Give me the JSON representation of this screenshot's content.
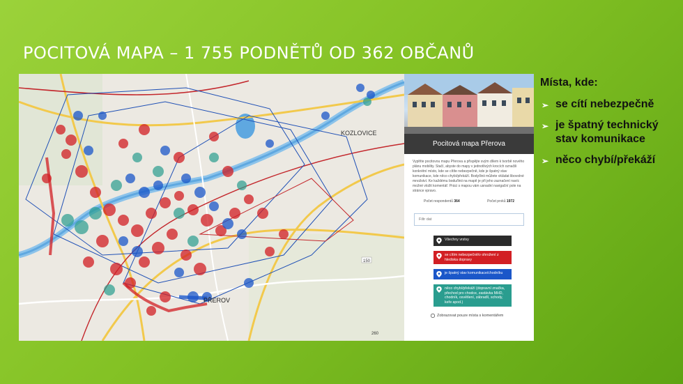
{
  "slide": {
    "title": "Pocitová mapa – 1 755 podnětů od 362 občanů"
  },
  "map": {
    "place_labels": [
      "KOZLOVICE",
      "PŘEROV"
    ],
    "road_number": "150",
    "bottom_number": "260",
    "colors": {
      "danger": "#d21f24",
      "technical": "#1b57c9",
      "missing": "#2a9d8f",
      "roads": "#f2c94c",
      "water": "#5fa8e0",
      "boundary": "#1e4fb5",
      "rail": "#c3262b"
    }
  },
  "panel": {
    "title": "Pocitová mapa Přerova",
    "description": "Vyplňte pocitovou mapu Přerova a přispějte svým dílem k tvorbě nového plánu mobility. Stačí, abyste do mapy v jednotlivých krocích označili konkrétní místo, kde se cítíte nebezpečně, kde je špatný stav komunikace, kde něco chybí/překáží. Body/linii můžete vkládat libovolné množství. Ke každému bodu/linii na mapě je při jeho zaznačení navíc možné vložit komentář. Práci s mapou vám usnadní navigační pole na stránce vpravo.",
    "stats": {
      "respondents_label": "Počet respondentů",
      "respondents_value": "364",
      "entries_label": "Počet prvků",
      "entries_value": "1972"
    },
    "filter_placeholder": "Filtr dat",
    "layers": [
      {
        "label": "Všechny vrstvy",
        "color": "#2b2b2b",
        "icon": "map-pin-icon"
      },
      {
        "label": "se cítím nebezpečně/v ohrožení z hlediska dopravy",
        "color": "#d21f24",
        "icon": "map-pin-icon"
      },
      {
        "label": "je špatný stav komunikace/chodníku",
        "color": "#1b57c9",
        "icon": "map-pin-icon"
      },
      {
        "label": "něco chybí/překáží (dopravní značka, přechod pro chodce, zastávka MHD, chodník, osvětlení, zábradlí, schody, keře apod.)",
        "color": "#2a9d8f",
        "icon": "map-pin-icon"
      }
    ],
    "checkbox_label": "Zobrazovat pouze místa s komentářem"
  },
  "bullets": {
    "heading": "Místa, kde:",
    "items": [
      "se cítí nebezpečně",
      "je špatný technický stav komunikace",
      "něco chybí/překáží"
    ]
  }
}
